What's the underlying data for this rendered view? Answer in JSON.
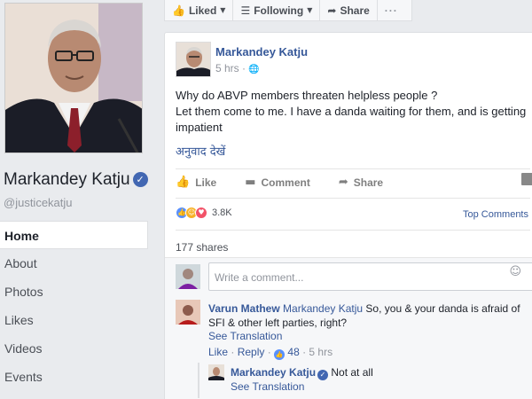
{
  "page": {
    "name": "Markandey Katju",
    "handle": "@justicekatju"
  },
  "nav": {
    "items": [
      "Home",
      "About",
      "Photos",
      "Likes",
      "Videos",
      "Events"
    ]
  },
  "topbar": {
    "liked_label": "Liked",
    "following_label": "Following",
    "share_label": "Share",
    "more_label": "···"
  },
  "post": {
    "author": "Markandey Katju",
    "time": "5 hrs",
    "text": "Why do ABVP members threaten helpless people ?\nLet them come to me. I have a danda waiting for them, and is getting impatient",
    "translate": "अनुवाद देखें",
    "actions": {
      "like": "Like",
      "comment": "Comment",
      "share": "Share"
    },
    "reaction_count": "3.8K",
    "top_comments": "Top Comments",
    "shares": "177 shares"
  },
  "comments": {
    "placeholder": "Write a comment...",
    "first": {
      "name": "Varun Mathew",
      "tag": "Markandey Katju",
      "text": "So, you & your danda is afraid of SFI & other left parties, right?",
      "see_translation": "See Translation",
      "like": "Like",
      "reply": "Reply",
      "likes": "48",
      "time": "5 hrs"
    },
    "reply": {
      "name": "Markandey Katju",
      "text": "Not at all",
      "see_translation": "See Translation"
    }
  },
  "colors": {
    "link": "#365899",
    "brand": "#4267b2",
    "background": "#e9ebee"
  }
}
